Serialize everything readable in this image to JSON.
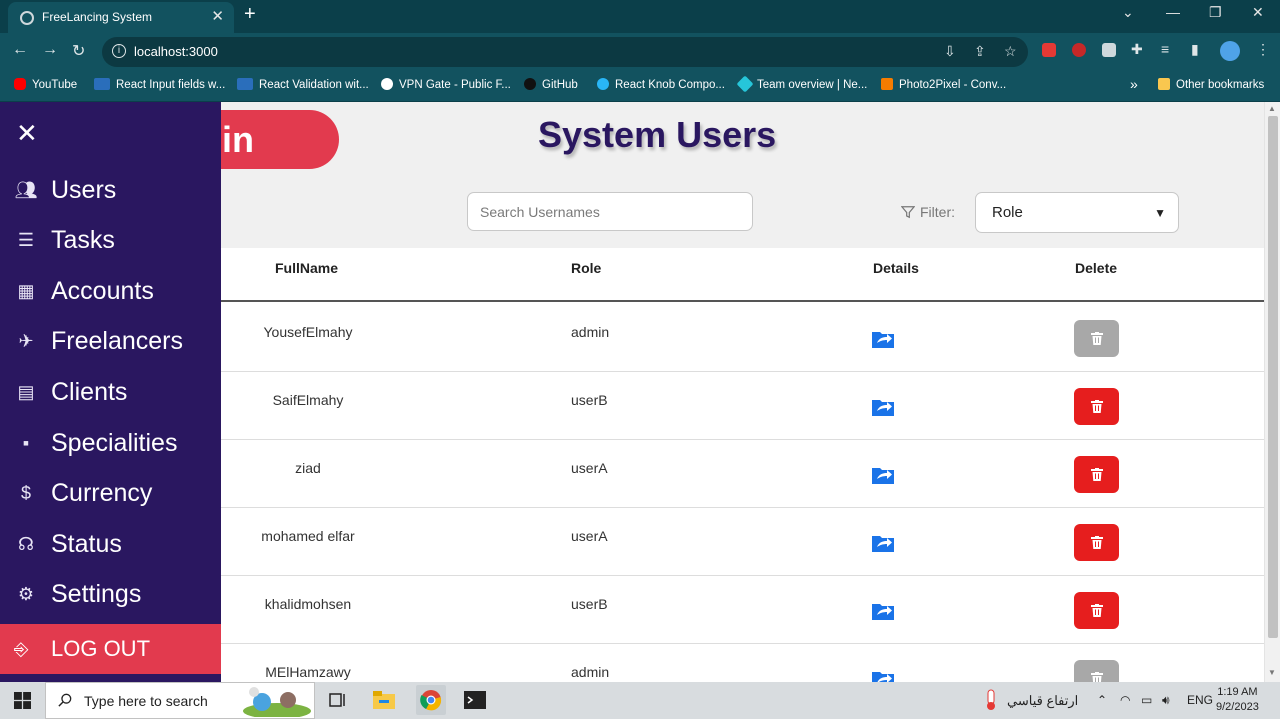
{
  "browser": {
    "tab_title": "FreeLancing System",
    "url": "localhost:3000",
    "bookmarks": [
      "YouTube",
      "React Input fields w...",
      "React Validation wit...",
      "VPN Gate - Public F...",
      "GitHub",
      "React Knob Compo...",
      "Team overview | Ne...",
      "Photo2Pixel - Conv..."
    ],
    "more_bookmarks": "»",
    "other_bookmarks": "Other bookmarks"
  },
  "sidebar": {
    "items": [
      {
        "label": "Users",
        "icon": "users-icon"
      },
      {
        "label": "Tasks",
        "icon": "tasks-icon"
      },
      {
        "label": "Accounts",
        "icon": "accounts-icon"
      },
      {
        "label": "Freelancers",
        "icon": "freelancers-icon"
      },
      {
        "label": "Clients",
        "icon": "clients-icon"
      },
      {
        "label": "Specialities",
        "icon": "specialities-icon"
      },
      {
        "label": "Currency",
        "icon": "currency-icon"
      },
      {
        "label": "Status",
        "icon": "status-icon"
      },
      {
        "label": "Settings",
        "icon": "settings-icon"
      }
    ],
    "logout": "LOG OUT"
  },
  "main": {
    "admin_badge": "in",
    "title": "System Users",
    "search_placeholder": "Search Usernames",
    "filter_label": "Filter:",
    "filter_value": "Role",
    "columns": [
      "FullName",
      "Role",
      "Details",
      "Delete"
    ],
    "rows": [
      {
        "fullname": "YousefElmahy",
        "role": "admin",
        "delete_enabled": false
      },
      {
        "fullname": "SaifElmahy",
        "role": "userB",
        "delete_enabled": true
      },
      {
        "fullname": "ziad",
        "role": "userA",
        "delete_enabled": true
      },
      {
        "fullname": "mohamed elfar",
        "role": "userA",
        "delete_enabled": true
      },
      {
        "fullname": "khalidmohsen",
        "role": "userB",
        "delete_enabled": true
      },
      {
        "fullname": "MElHamzawy",
        "role": "admin",
        "delete_enabled": false
      }
    ]
  },
  "taskbar": {
    "search_placeholder": "Type here to search",
    "weather_text": "ارتفاع قياسي",
    "language": "ENG",
    "time": "1:19 AM",
    "date": "9/2/2023"
  },
  "colors": {
    "sidebar": "#2a1760",
    "accent_red": "#e23a4e",
    "delete_red": "#e61e1e",
    "delete_disabled": "#a8a8a8",
    "details_blue": "#1a73e8"
  }
}
